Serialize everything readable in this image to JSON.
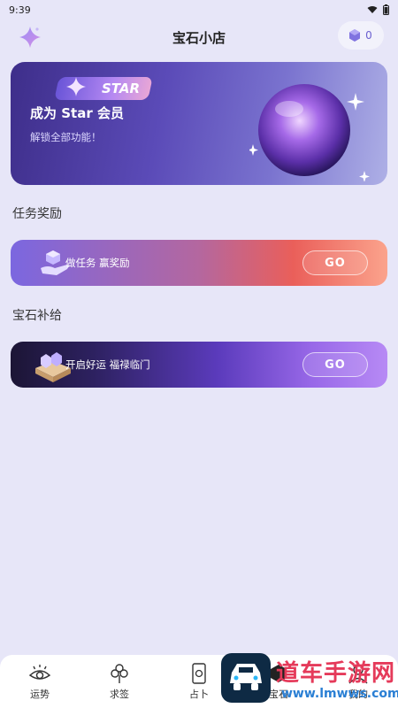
{
  "status": {
    "time": "9:39"
  },
  "header": {
    "title": "宝石小店",
    "gem_count": "0"
  },
  "star_banner": {
    "badge": "STAR",
    "title": "成为 Star 会员",
    "subtitle": "解锁全部功能！"
  },
  "sections": {
    "tasks_title": "任务奖励",
    "supply_title": "宝石补给"
  },
  "task_card": {
    "text": "做任务 赢奖励",
    "button": "GO"
  },
  "supply_card": {
    "text": "开启好运 福禄临门",
    "button": "GO"
  },
  "tabs": [
    {
      "label": "运势",
      "icon": "eye-icon"
    },
    {
      "label": "求签",
      "icon": "clover-icon"
    },
    {
      "label": "占卜",
      "icon": "tarot-card-icon"
    },
    {
      "label": "宝石",
      "icon": "gem-icon"
    },
    {
      "label": "我的",
      "icon": "profile-icon"
    }
  ],
  "watermark": {
    "big": "道车手游网",
    "small": "www.lmwws.com"
  }
}
